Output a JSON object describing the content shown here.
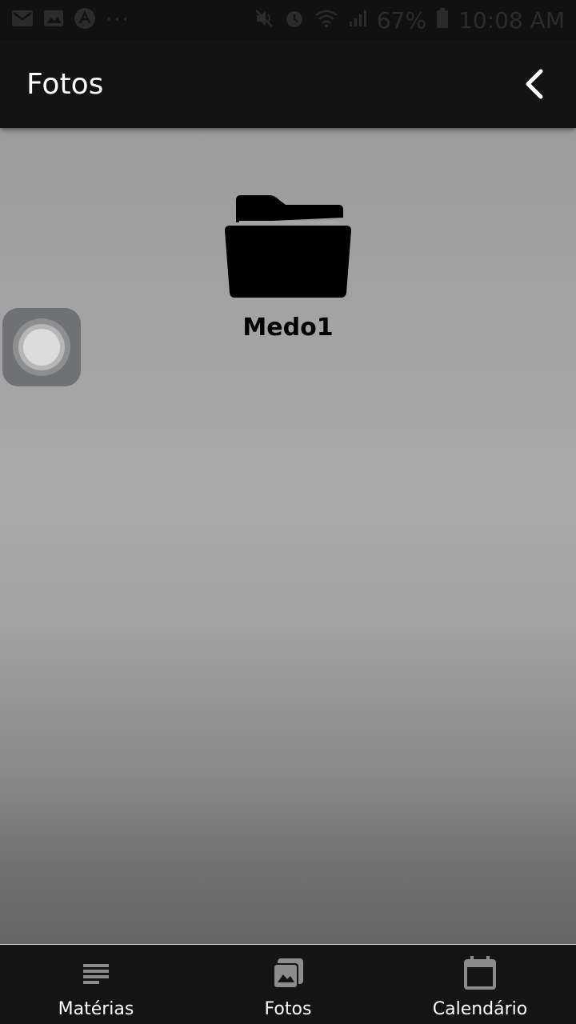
{
  "status_bar": {
    "icons_left": [
      "mail-icon",
      "image-icon",
      "app-icon"
    ],
    "overflow": "···",
    "icons_right": [
      "mute-icon",
      "alarm-icon",
      "wifi-icon",
      "signal-icon"
    ],
    "battery": "67%",
    "time": "10:08 AM"
  },
  "appbar": {
    "title": "Fotos",
    "back_icon": "chevron-left-icon"
  },
  "content": {
    "folders": [
      {
        "name": "Medo1",
        "icon": "folder-icon"
      }
    ]
  },
  "bottom_nav": {
    "items": [
      {
        "label": "Matérias",
        "icon": "list-icon"
      },
      {
        "label": "Fotos",
        "icon": "photos-icon"
      },
      {
        "label": "Calendário",
        "icon": "calendar-icon"
      }
    ]
  },
  "colors": {
    "appbar_bg": "#131313",
    "nav_bg": "#141414",
    "icon_gray": "#8c8c8c"
  }
}
